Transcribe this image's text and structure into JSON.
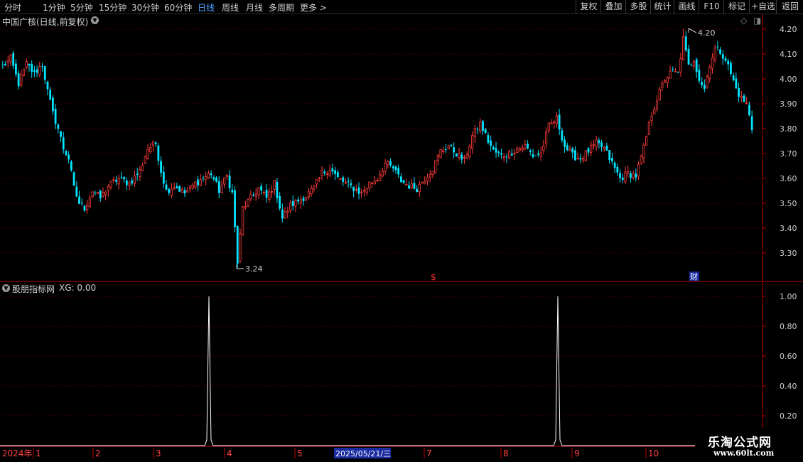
{
  "toolbar": {
    "tabs": [
      "分时",
      "1分钟",
      "5分钟",
      "15分钟",
      "30分钟",
      "60分钟",
      "日线",
      "周线",
      "月线",
      "多周期",
      "更多"
    ],
    "active_tab": "日线",
    "right_buttons": [
      "复权",
      "叠加",
      "多股",
      "统计",
      "画线",
      "F10",
      "标记",
      "+自选",
      "返回"
    ]
  },
  "main_chart": {
    "title": "中国广核(日线,前复权)",
    "high_label": "4.20",
    "low_label": "3.24",
    "event_marker": "$",
    "cai_marker": "财",
    "yaxis": [
      "4.20",
      "4.10",
      "4.00",
      "3.90",
      "3.80",
      "3.70",
      "3.60",
      "3.50",
      "3.40",
      "3.30"
    ]
  },
  "indicator": {
    "title": "股朋指标网",
    "value_text": "XG: 0.00",
    "yaxis": [
      "1.00",
      "0.80",
      "0.60",
      "0.40",
      "0.20"
    ]
  },
  "date_axis": {
    "year": "2024年",
    "months": [
      "1",
      "2",
      "3",
      "4",
      "5",
      "7",
      "8",
      "9",
      "10"
    ],
    "cursor_date": "2025/05/21/三"
  },
  "watermark": {
    "line1": "乐淘公式网",
    "line2": "www.60lt.com"
  },
  "chart_data": {
    "type": "candlestick",
    "ylim": [
      3.2,
      4.23
    ],
    "close_anchors": [
      [
        0,
        4.05
      ],
      [
        3,
        4.08
      ],
      [
        6,
        3.98
      ],
      [
        9,
        4.06
      ],
      [
        12,
        4.02
      ],
      [
        15,
        4.06
      ],
      [
        17,
        3.95
      ],
      [
        19,
        3.86
      ],
      [
        21,
        3.8
      ],
      [
        23,
        3.72
      ],
      [
        25,
        3.68
      ],
      [
        27,
        3.56
      ],
      [
        29,
        3.5
      ],
      [
        31,
        3.48
      ],
      [
        34,
        3.55
      ],
      [
        37,
        3.52
      ],
      [
        40,
        3.57
      ],
      [
        44,
        3.6
      ],
      [
        48,
        3.58
      ],
      [
        52,
        3.63
      ],
      [
        55,
        3.72
      ],
      [
        58,
        3.74
      ],
      [
        60,
        3.63
      ],
      [
        62,
        3.55
      ],
      [
        65,
        3.57
      ],
      [
        69,
        3.54
      ],
      [
        73,
        3.58
      ],
      [
        76,
        3.6
      ],
      [
        79,
        3.62
      ],
      [
        82,
        3.55
      ],
      [
        85,
        3.61
      ],
      [
        87,
        3.54
      ],
      [
        89,
        3.26
      ],
      [
        91,
        3.48
      ],
      [
        94,
        3.52
      ],
      [
        97,
        3.56
      ],
      [
        100,
        3.52
      ],
      [
        103,
        3.58
      ],
      [
        106,
        3.44
      ],
      [
        109,
        3.49
      ],
      [
        112,
        3.51
      ],
      [
        115,
        3.53
      ],
      [
        118,
        3.56
      ],
      [
        121,
        3.62
      ],
      [
        124,
        3.64
      ],
      [
        127,
        3.6
      ],
      [
        130,
        3.58
      ],
      [
        133,
        3.56
      ],
      [
        136,
        3.54
      ],
      [
        139,
        3.58
      ],
      [
        142,
        3.6
      ],
      [
        145,
        3.66
      ],
      [
        148,
        3.64
      ],
      [
        151,
        3.59
      ],
      [
        154,
        3.57
      ],
      [
        157,
        3.56
      ],
      [
        160,
        3.6
      ],
      [
        163,
        3.64
      ],
      [
        166,
        3.71
      ],
      [
        169,
        3.73
      ],
      [
        172,
        3.7
      ],
      [
        175,
        3.67
      ],
      [
        178,
        3.77
      ],
      [
        181,
        3.82
      ],
      [
        184,
        3.75
      ],
      [
        186,
        3.71
      ],
      [
        189,
        3.69
      ],
      [
        192,
        3.7
      ],
      [
        195,
        3.72
      ],
      [
        198,
        3.73
      ],
      [
        201,
        3.69
      ],
      [
        204,
        3.7
      ],
      [
        207,
        3.81
      ],
      [
        210,
        3.84
      ],
      [
        213,
        3.73
      ],
      [
        216,
        3.69
      ],
      [
        219,
        3.68
      ],
      [
        222,
        3.71
      ],
      [
        225,
        3.74
      ],
      [
        228,
        3.72
      ],
      [
        231,
        3.66
      ],
      [
        234,
        3.6
      ],
      [
        237,
        3.62
      ],
      [
        240,
        3.61
      ],
      [
        243,
        3.72
      ],
      [
        246,
        3.86
      ],
      [
        248,
        3.92
      ],
      [
        251,
        4.0
      ],
      [
        254,
        4.03
      ],
      [
        256,
        4.02
      ],
      [
        258,
        4.16
      ],
      [
        260,
        4.05
      ],
      [
        262,
        4.08
      ],
      [
        264,
        4.0
      ],
      [
        266,
        3.96
      ],
      [
        268,
        4.06
      ],
      [
        270,
        4.12
      ],
      [
        272,
        4.11
      ],
      [
        274,
        4.08
      ],
      [
        276,
        4.02
      ],
      [
        278,
        3.96
      ],
      [
        280,
        3.92
      ],
      [
        282,
        3.9
      ],
      [
        284,
        3.8
      ]
    ],
    "high": 4.2,
    "low": 3.24,
    "indicator_spikes_x": [
      294,
      785
    ],
    "indicator_ylim": [
      0,
      1.0
    ]
  }
}
